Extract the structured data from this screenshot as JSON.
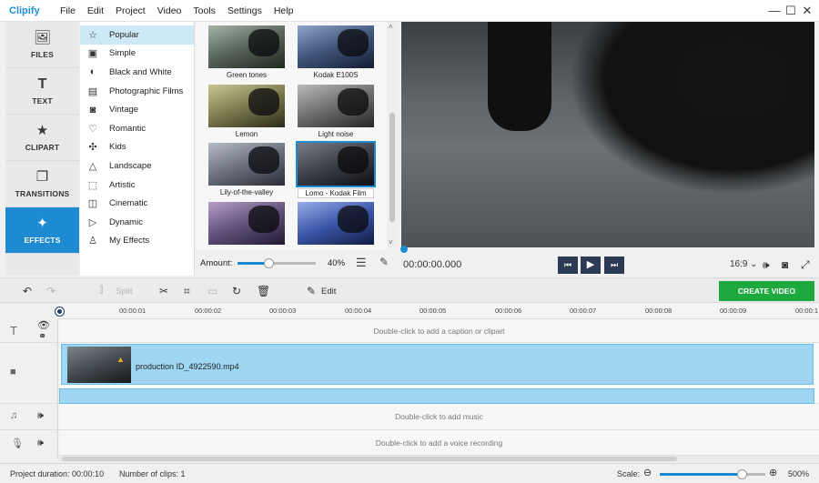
{
  "app": {
    "title": "Clipify"
  },
  "menu": [
    "File",
    "Edit",
    "Project",
    "Video",
    "Tools",
    "Settings",
    "Help"
  ],
  "window_controls": {
    "minimize": "—",
    "maximize": "☐",
    "close": "✕"
  },
  "left_tabs": [
    {
      "label": "FILES",
      "icon": "image-icon",
      "glyph": "🖼"
    },
    {
      "label": "TEXT",
      "icon": "text-icon",
      "glyph": "T"
    },
    {
      "label": "CLIPART",
      "icon": "star-icon",
      "glyph": "★"
    },
    {
      "label": "TRANSITIONS",
      "icon": "transitions-icon",
      "glyph": "❐"
    },
    {
      "label": "EFFECTS",
      "icon": "effects-icon",
      "glyph": "✦",
      "active": true
    }
  ],
  "categories": [
    {
      "label": "Popular",
      "icon": "star-outline-icon",
      "glyph": "☆",
      "selected": true
    },
    {
      "label": "Simple",
      "icon": "simple-icon",
      "glyph": "▣"
    },
    {
      "label": "Black and White",
      "icon": "bw-icon",
      "glyph": "◐"
    },
    {
      "label": "Photographic Films",
      "icon": "film-icon",
      "glyph": "▤"
    },
    {
      "label": "Vintage",
      "icon": "camera-icon",
      "glyph": "◙"
    },
    {
      "label": "Romantic",
      "icon": "heart-icon",
      "glyph": "♡"
    },
    {
      "label": "Kids",
      "icon": "kids-icon",
      "glyph": "✣"
    },
    {
      "label": "Landscape",
      "icon": "mountain-icon",
      "glyph": "△"
    },
    {
      "label": "Artistic",
      "icon": "artistic-icon",
      "glyph": "⬚"
    },
    {
      "label": "Cinematic",
      "icon": "cinematic-icon",
      "glyph": "◫"
    },
    {
      "label": "Dynamic",
      "icon": "dynamic-icon",
      "glyph": "▷"
    },
    {
      "label": "My Effects",
      "icon": "user-icon",
      "glyph": "♙"
    }
  ],
  "thumbnails": [
    {
      "label": "Green tones"
    },
    {
      "label": "Kodak E100S"
    },
    {
      "label": "Lemon"
    },
    {
      "label": "Light noise"
    },
    {
      "label": "Lily-of-the-valley"
    },
    {
      "label": "Lomo - Kodak Film",
      "selected": true
    },
    {
      "label": ""
    },
    {
      "label": ""
    }
  ],
  "amount": {
    "label": "Amount:",
    "value": "40%",
    "fraction": 0.4
  },
  "player": {
    "timecode": "00:00:00.000",
    "aspect": "16:9 ⌄"
  },
  "toolbar": {
    "split": "Split",
    "edit": "Edit",
    "create": "CREATE VIDEO"
  },
  "ruler": [
    "00:00:01",
    "00:00:02",
    "00:00:03",
    "00:00:04",
    "00:00:05",
    "00:00:06",
    "00:00:07",
    "00:00:08",
    "00:00:09",
    "00:00:1"
  ],
  "tracks": {
    "caption_hint": "Double-click to add a caption or clipart",
    "clip_name": "production ID_4922590.mp4",
    "music_hint": "Double-click to add music",
    "voice_hint": "Double-click to add a voice recording"
  },
  "status": {
    "duration": "Project duration:  00:00:10",
    "clips": "Number of clips: 1",
    "scale_label": "Scale:",
    "scale_value": "500%",
    "scale_fraction": 0.78
  }
}
